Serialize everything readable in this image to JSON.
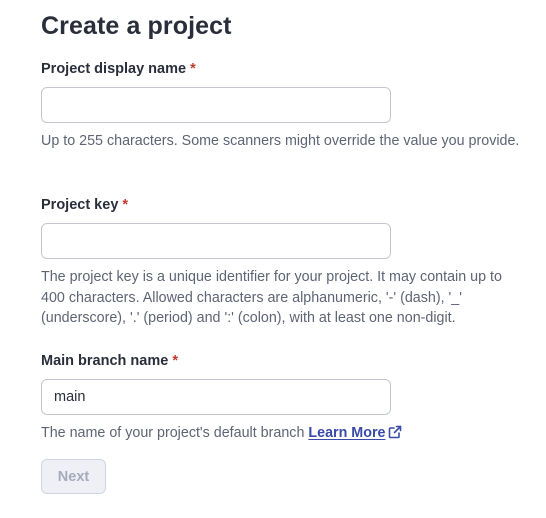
{
  "form": {
    "title": "Create a project",
    "required_marker": "*",
    "display_name": {
      "label": "Project display name",
      "value": "",
      "help": "Up to 255 characters. Some scanners might override the value you provide."
    },
    "project_key": {
      "label": "Project key",
      "value": "",
      "help": "The project key is a unique identifier for your project. It may contain up to 400 characters. Allowed characters are alphanumeric, '-' (dash), '_' (underscore), '.' (period) and ':' (colon), with at least one non-digit."
    },
    "main_branch": {
      "label": "Main branch name",
      "value": "main",
      "help": "The name of your project's default branch",
      "link_label": "Learn More",
      "link_icon": "external-link-icon"
    },
    "next_button": {
      "label": "Next",
      "disabled": true
    }
  },
  "colors": {
    "text": "#2a2e3a",
    "required": "#c0392b",
    "help_text": "#5e6474",
    "link": "#3a4aa8",
    "input_border": "#c4c7d2",
    "button_disabled_bg": "#eef0f6",
    "button_disabled_text": "#a6abbc"
  }
}
